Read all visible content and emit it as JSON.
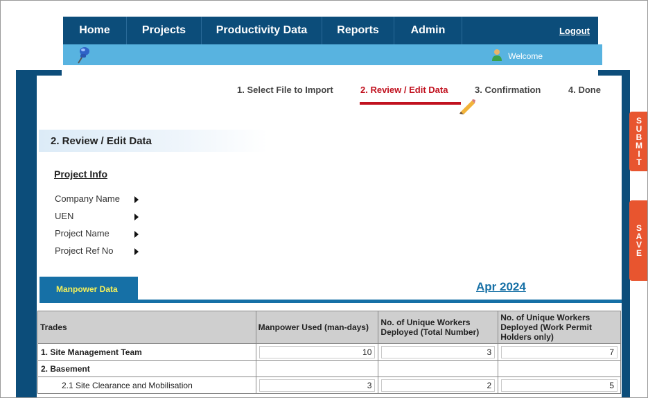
{
  "nav": {
    "items": [
      "Home",
      "Projects",
      "Productivity Data",
      "Reports",
      "Admin"
    ],
    "logout": "Logout"
  },
  "subbar": {
    "welcome": "Welcome"
  },
  "steps": [
    "1. Select File to Import",
    "2. Review / Edit Data",
    "3. Confirmation",
    "4. Done"
  ],
  "section": {
    "title": "2.  Review / Edit Data"
  },
  "project_info": {
    "title": "Project Info",
    "fields": [
      "Company Name",
      "UEN",
      "Project Name",
      "Project Ref No"
    ]
  },
  "tab": {
    "label": "Manpower Data",
    "period": "Apr 2024"
  },
  "side_buttons": {
    "submit": "SUBMIT",
    "save": "SAVE"
  },
  "table": {
    "headers": [
      "Trades",
      "Manpower Used (man-days)",
      "No. of Unique Workers Deployed (Total Number)",
      "No. of Unique Workers Deployed (Work Permit Holders only)"
    ],
    "rows": [
      {
        "trade": "1. Site Management Team",
        "used": "10",
        "total": "3",
        "wp": "7"
      },
      {
        "trade": "2. Basement",
        "used": "",
        "total": "",
        "wp": ""
      },
      {
        "trade": "2.1 Site Clearance and Mobilisation",
        "used": "3",
        "total": "2",
        "wp": "5"
      }
    ]
  },
  "colors": {
    "nav": "#0c4d7a",
    "subbar": "#58b3e0",
    "active_step": "#c1121f",
    "tab": "#1670a6",
    "side_button": "#e8552f"
  }
}
